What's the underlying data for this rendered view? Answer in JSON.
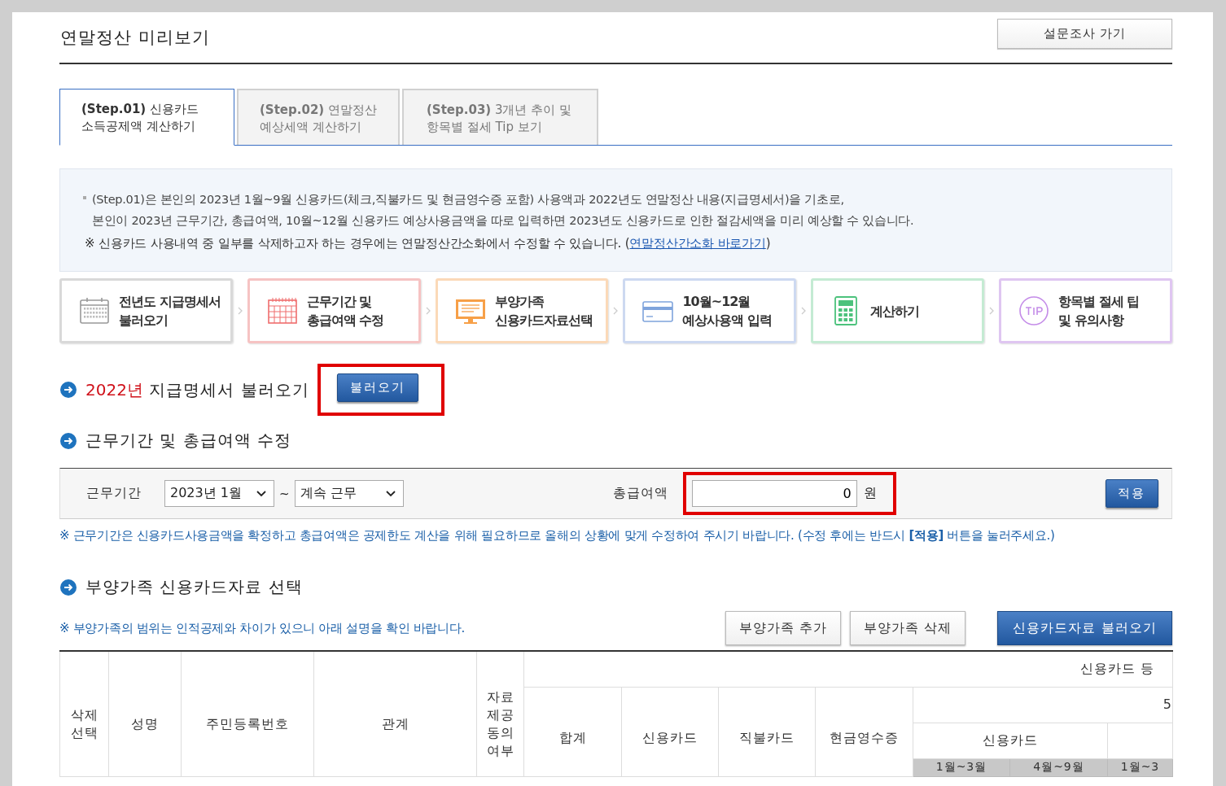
{
  "header": {
    "title": "연말정산 미리보기",
    "survey_button": "설문조사 가기"
  },
  "tabs": [
    {
      "label": "**(Step.01)** 신용카드",
      "line2": "소득공제액 계산하기",
      "selected": true
    },
    {
      "label": "**(Step.02)** 연말정산",
      "line2": "예상세액 계산하기",
      "selected": false
    },
    {
      "label": "**(Step.03)** 3개년 추이 및",
      "line2": "항목별 절세 Tip 보기",
      "selected": false
    }
  ],
  "info": {
    "lines": [
      "(Step.01)은 본인의 2023년 1월~9월 신용카드(체크,직불카드 및 현금영수증 포함) 사용액과 2022년도 연말정산 내용(지급명세서)을 기초로,",
      "본인이 2023년 근무기간, 총급여액, 10월~12월 신용카드 예상사용금액을 따로 입력하면 2023년도 신용카드로 인한 절감세액을 미리 예상할 수 있습니다."
    ],
    "notice": "※ 신용카드 사용내역 중 일부를 삭제하고자 하는 경우에는 연말정산간소화에서 수정할 수 있습니다. (",
    "notice_link": "연말정산간소화 바로가기",
    "notice_end": ")"
  },
  "steps": [
    {
      "kind": "calendar",
      "lines": [
        "전년도 지급명세서",
        "불러오기"
      ],
      "color": "#d9d9d9"
    },
    {
      "kind": "grid",
      "lines": [
        "근무기간 및",
        "총급여액 수정"
      ],
      "color": "#f6c3c3"
    },
    {
      "kind": "monitor",
      "lines": [
        "부양가족",
        "신용카드자료선택"
      ],
      "color": "#fbd9b8"
    },
    {
      "kind": "card",
      "lines": [
        "10월~12월",
        "예상사용액 입력"
      ],
      "color": "#cdd9f1"
    },
    {
      "kind": "calculator",
      "lines": [
        "계산하기"
      ],
      "color": "#c4ebd3"
    },
    {
      "kind": "tip",
      "lines": [
        "항목별 절세 팁",
        "및 유의사항"
      ],
      "color": "#dfc6f1"
    }
  ],
  "section_load": {
    "title_accent": "2022년",
    "title": "지급명세서 불러오기",
    "button": "불러오기",
    "highlighted": true
  },
  "section_edit": {
    "title": "근무기간 및 총급여액 수정",
    "period_label": "근무기간",
    "start_select": "2023년 1월",
    "separator": "~",
    "end_select": "계속 근무",
    "total_label": "총급여액",
    "total_value": "0",
    "unit": "원",
    "total_highlighted": true,
    "apply_button": "적용",
    "note": "※ 근무기간은 신용카드사용금액을 확정하고 총급여액은 공제한도 계산을 위해 필요하므로 올해의 상황에 맞게 수정하여 주시기 바랍니다. (수정 후에는 반드시 **[적용]** 버튼을 눌러주세요.)"
  },
  "section_family": {
    "title": "부양가족 신용카드자료 선택",
    "note": "※ 부양가족의 범위는 인적공제와 차이가 있으니 아래 설명을 확인 바랍니다.",
    "buttons": [
      {
        "label": "부양가족 추가",
        "kind": "plain"
      },
      {
        "label": "부양가족 삭제",
        "kind": "plain"
      },
      {
        "label": "신용카드자료 불러오기",
        "kind": "primary"
      }
    ],
    "table": {
      "left_columns": [
        [
          "삭제",
          "선택"
        ],
        [
          "성명"
        ],
        [
          "주민등록번호"
        ],
        [
          "관계"
        ],
        [
          "자료",
          "제공",
          "동의",
          "여부"
        ]
      ],
      "group_header": "신용카드 등",
      "subgroup_header": "5",
      "amount_columns": [
        "합계",
        "신용카드",
        "직불카드",
        "현금영수증"
      ],
      "card_header": "신용카드",
      "period_columns": [
        "1월~3월",
        "4월~9월",
        "1월~3"
      ]
    }
  }
}
